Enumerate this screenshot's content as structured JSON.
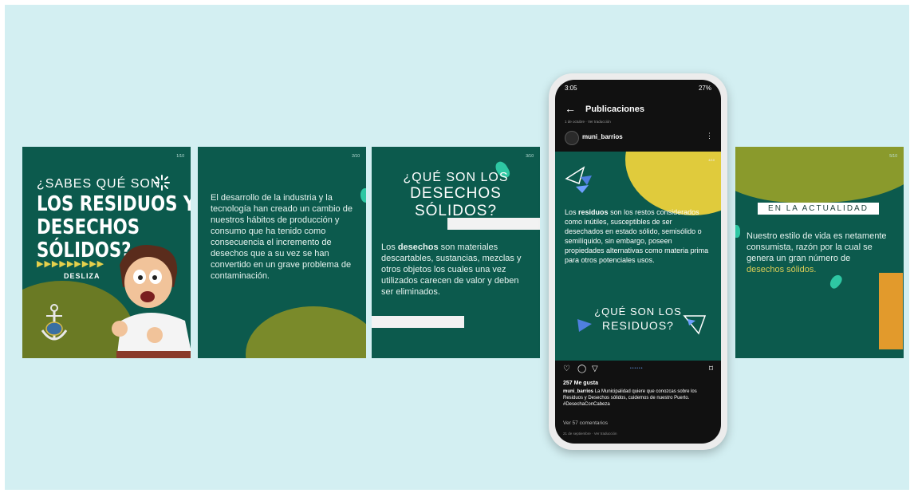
{
  "slides": {
    "slide1": {
      "page": "1/10",
      "title_line1": "¿SABES QUÉ SON",
      "title_line2": "LOS RESIDUOS Y",
      "title_line3": "DESECHOS SÓLIDOS?",
      "arrows": "▶▶▶▶▶▶▶▶▶",
      "swipe_label": "DESLIZA"
    },
    "slide2": {
      "page": "2/10",
      "text": "El desarrollo de la industria y la tecnología han creado un cambio de nuestros hábitos de producción y consumo que ha tenido como consecuencia el incremento de desechos que a su vez se han convertido en un grave problema de contaminación."
    },
    "slide3": {
      "page": "3/10",
      "heading_line1": "¿QUÉ SON LOS",
      "heading_line2": "DESECHOS SÓLIDOS?",
      "text_lead": "Los",
      "text_bold": "desechos",
      "text_rest": "son materiales descartables, sustancias, mezclas y otros objetos los cuales una vez utilizados carecen de valor y deben ser eliminados."
    },
    "slide5": {
      "page": "5/10",
      "label": "EN LA ACTUALIDAD",
      "text_start": "Nuestro estilo de vida es netamente consumista, razón por la cual se genera un gran número de",
      "text_highlight": "desechos sólidos."
    }
  },
  "phone": {
    "status_time": "3:05",
    "status_right": "27%",
    "topbar_title": "Publicaciones",
    "topbar_sub": "1 de octubre · Ver traducción",
    "username": "muni_barrios",
    "post": {
      "page": "4/10",
      "text_lead": "Los",
      "text_bold": "residuos",
      "text_rest": "son los restos considerados como inútiles, susceptibles de ser desechados en estado sólido, semisólido o semilíquido, sin embargo, poseen propiedades alternativas como materia prima para otros potenciales usos.",
      "heading_line1": "¿QUÉ SON LOS",
      "heading_line2": "RESIDUOS?"
    },
    "carousel_dots": "••••••",
    "likes": "257 Me gusta",
    "caption_user": "muni_barrios",
    "caption_text": "La Municipalidad quiere que conozcas sobre los Residuos y Desechos sólidos, cuidemos de nuestro Puerto. #DesechaConCabeza",
    "comments": "Ver 57 comentarios",
    "date": "21 de septiembre · Ver traducción"
  },
  "icons": {
    "back": "arrow-left-icon",
    "more": "more-vertical-icon",
    "like": "heart-icon",
    "comment": "comment-icon",
    "share": "send-icon",
    "save": "bookmark-icon"
  },
  "colors": {
    "stage": "#d3eff2",
    "slide": "#0c5a4d",
    "olive": "#6a7a24",
    "yellow": "#e0cb3c",
    "accent": "#2ec7a3"
  }
}
